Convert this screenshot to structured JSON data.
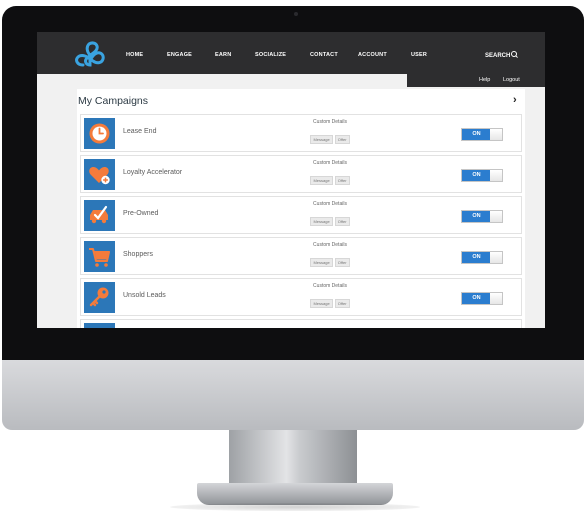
{
  "nav": {
    "items": [
      "HOME",
      "ENGAGE",
      "EARN",
      "SOCIALIZE",
      "CONTACT",
      "ACCOUNT",
      "USER"
    ],
    "search_label": "SEARCH",
    "help_label": "Help",
    "logout_label": "Logout"
  },
  "panel": {
    "title": "My Campaigns"
  },
  "campaigns": [
    {
      "label": "Lease End",
      "icon": "clock-icon",
      "custom_details": "Custom Details",
      "message_btn": "Message",
      "offer_btn": "Offer",
      "toggle": "ON"
    },
    {
      "label": "Loyalty Accelerator",
      "icon": "heart-plus-icon",
      "custom_details": "Custom Details",
      "message_btn": "Message",
      "offer_btn": "Offer",
      "toggle": "ON"
    },
    {
      "label": "Pre-Owned",
      "icon": "car-check-icon",
      "custom_details": "Custom Details",
      "message_btn": "Message",
      "offer_btn": "Offer",
      "toggle": "ON"
    },
    {
      "label": "Shoppers",
      "icon": "cart-icon",
      "custom_details": "Custom Details",
      "message_btn": "Message",
      "offer_btn": "Offer",
      "toggle": "ON"
    },
    {
      "label": "Unsold Leads",
      "icon": "key-icon",
      "custom_details": "Custom Details",
      "message_btn": "Message",
      "offer_btn": "Offer",
      "toggle": "ON"
    }
  ],
  "colors": {
    "navbar": "#2d2d2f",
    "accent_blue": "#2b7dcf",
    "icon_blue": "#2c77b8",
    "icon_orange": "#f47b3b"
  }
}
